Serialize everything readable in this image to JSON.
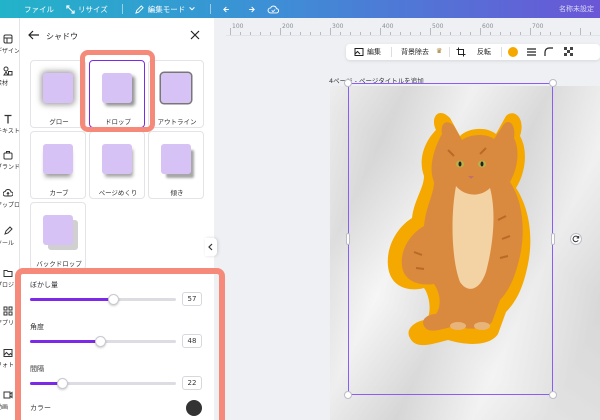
{
  "topbar": {
    "file_label": "ファイル",
    "resize_label": "リサイズ",
    "edit_mode_label": "編集モード",
    "doc_name": "名称未設定"
  },
  "rail": {
    "items": [
      {
        "label": "デザイン",
        "icon": "design-icon"
      },
      {
        "label": "素材",
        "icon": "elements-icon"
      },
      {
        "label": "テキスト",
        "icon": "text-icon"
      },
      {
        "label": "ブランド",
        "icon": "brand-icon"
      },
      {
        "label": "アップロード",
        "icon": "upload-icon"
      },
      {
        "label": "ツール",
        "icon": "draw-icon"
      },
      {
        "label": "プロジェクト",
        "icon": "folder-icon"
      },
      {
        "label": "アプリ",
        "icon": "apps-icon"
      },
      {
        "label": "フォト",
        "icon": "photo-icon"
      },
      {
        "label": "動画",
        "icon": "video-icon"
      }
    ]
  },
  "panel": {
    "title": "シャドウ",
    "options": [
      {
        "label": "グロー"
      },
      {
        "label": "ドロップ"
      },
      {
        "label": "アウトライン"
      },
      {
        "label": "カーブ"
      },
      {
        "label": "ページめくり"
      },
      {
        "label": "傾き"
      },
      {
        "label": "バックドロップ"
      }
    ],
    "selected": "ドロップ",
    "sliders": [
      {
        "label": "ぼかし量",
        "value": "57",
        "fraction": 0.57
      },
      {
        "label": "角度",
        "value": "48",
        "fraction": 0.48
      },
      {
        "label": "間隔",
        "value": "22",
        "fraction": 0.22
      }
    ],
    "color_label": "カラー",
    "shadow_color": "#333333"
  },
  "context_toolbar": {
    "edit_label": "編集",
    "bg_remove_label": "背景除去",
    "flip_label": "反転",
    "accent_color": "#f5a800"
  },
  "canvas": {
    "page_label": "4ページ - ページタイトルを追加",
    "ruler_numbers": [
      "100",
      "200",
      "300",
      "400",
      "500",
      "600",
      "700"
    ]
  },
  "colors": {
    "accent": "#7d2ae8",
    "highlight": "#f58a7a",
    "outline": "#f5a800"
  }
}
